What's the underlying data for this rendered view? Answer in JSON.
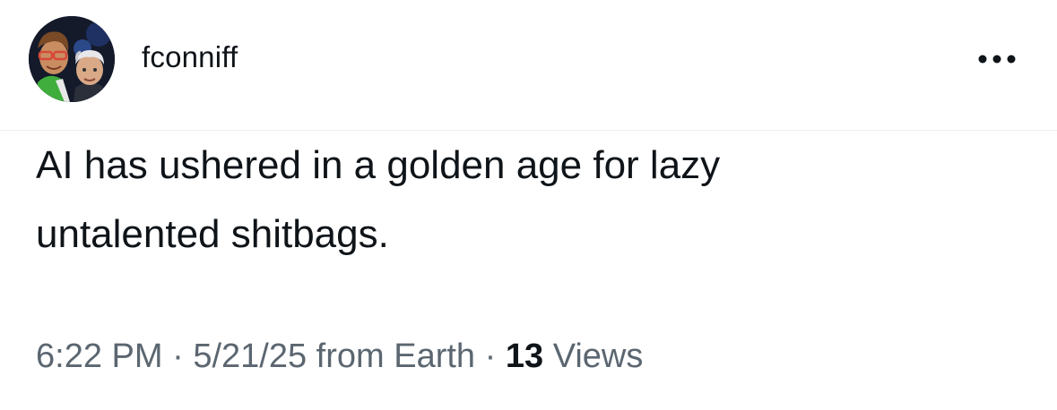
{
  "post": {
    "author": {
      "username": "fconniff",
      "avatar_icon": "profile-avatar-icon"
    },
    "more_icon": "more-horizontal-icon",
    "text": "AI has ushered in a golden age for lazy\nuntalented shitbags.",
    "meta": {
      "time": "6:22 PM",
      "separator": "·",
      "date": "5/21/25",
      "location": "from Earth",
      "views_count": "13",
      "views_label": "Views"
    }
  },
  "colors": {
    "text_primary": "#0f1419",
    "text_secondary": "#5b6670",
    "divider": "#eceef0",
    "background": "#ffffff"
  }
}
